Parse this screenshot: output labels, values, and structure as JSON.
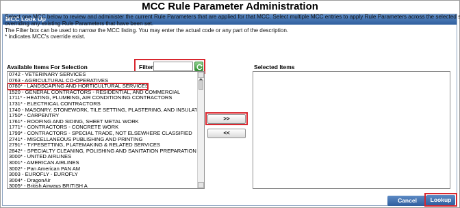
{
  "page": {
    "title": "MCC Rule Parameter Administration"
  },
  "panel": {
    "header": "MCC Look Up",
    "instructions": [
      "Select one MCC below to review and administer the current Rule Parameters that are applied for that MCC. Select multiple MCC entries to apply Rule Parameters across the selected set,",
      "overriding any existing Rule Parameters that have been set.",
      "The Filter box can be used to narrow the MCC listing. You may enter the actual code or any part of the description.",
      "* indicates MCC's override exist."
    ]
  },
  "available": {
    "label": "Available Items For Selection",
    "items": [
      "0742 - VETERINARY SERVICES",
      "0763 - AGRICULTURAL CO-OPERATIVES",
      "0780* - LANDSCAPING AND HORTICULTURAL SERVICES",
      "1520 - GENERAL CONTRACTORS - RESIDENTIAL, AND COMMERCIAL",
      "1711* - HEATING, PLUMBING, AIR CONDITIONING CONTRACTORS",
      "1731* - ELECTRICAL CONTRACTORS",
      "1740 - MASONRY, STONEWORK, TILE SETTING, PLASTERING, AND INSULATION",
      "1750* - CARPENTRY",
      "1761* - ROOFING AND SIDING, SHEET METAL WORK",
      "1771* - CONTRACTORS - CONCRETE WORK",
      "1799* - CONTRACTORS - SPECIAL TRADE, NOT ELSEWHERE CLASSIFIED",
      "2741* - MISCELLANEOUS PUBLISHING AND PRINTING",
      "2791* - TYPESETTING, PLATEMAKING & RELATED SERVICES",
      "2842* - SPECIALTY CLEANING, POLISHING AND SANITATION PREPARATIONS",
      "3000* - UNITED AIRLINES",
      "3001* - AMERICAN AIRLINES",
      "3002* - Pan American PAN AM",
      "3003 - EUROFLY - EUROFLY",
      "3004* - DragonAir",
      "3005* - British Airways BRITISH A"
    ],
    "selected_index": 2
  },
  "filter": {
    "label": "Filter:",
    "value": ""
  },
  "buttons": {
    "add": ">>",
    "remove": "<<",
    "cancel": "Cancel",
    "lookup": "Lookup"
  },
  "selected": {
    "label": "Selected Items",
    "items": []
  },
  "colors": {
    "accent": "#2f5f9e",
    "highlight": "#d9262e"
  },
  "icons": {
    "refresh": "refresh-icon"
  }
}
